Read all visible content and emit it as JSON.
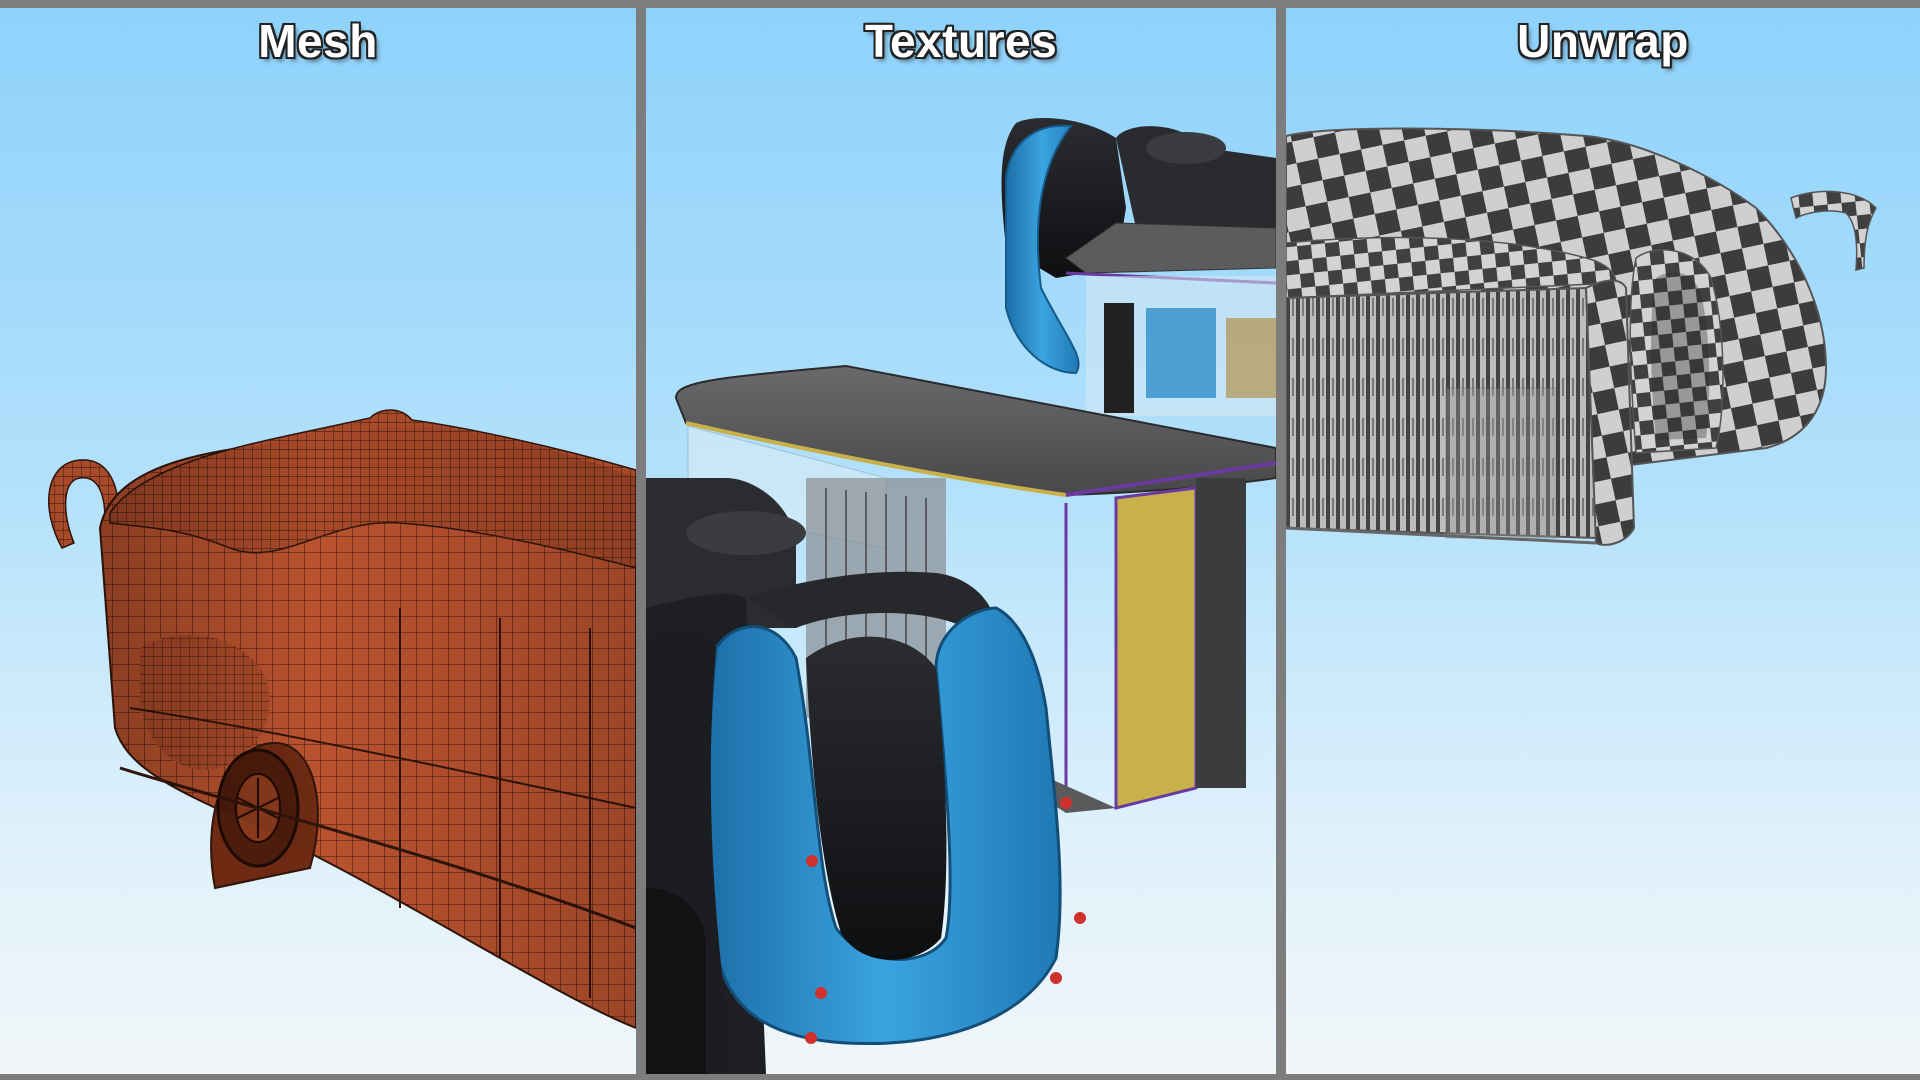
{
  "panels": [
    {
      "id": "mesh",
      "title": "Mesh"
    },
    {
      "id": "textures",
      "title": "Textures"
    },
    {
      "id": "unwrap",
      "title": "Unwrap"
    }
  ],
  "colors": {
    "sky_top": "#8ed2fb",
    "sky_bottom": "#f1f6f9",
    "divider": "#7d7d7d",
    "mesh_body": "#b9522f",
    "bus_blue": "#2e95d0",
    "bus_black": "#1d1f22",
    "roof_gray": "#5a5a5c",
    "accent_yellow": "#c8b04a",
    "accent_purple": "#6a3aa0",
    "checker_dark": "#3c3c3c",
    "checker_light": "#cfcfcf"
  }
}
